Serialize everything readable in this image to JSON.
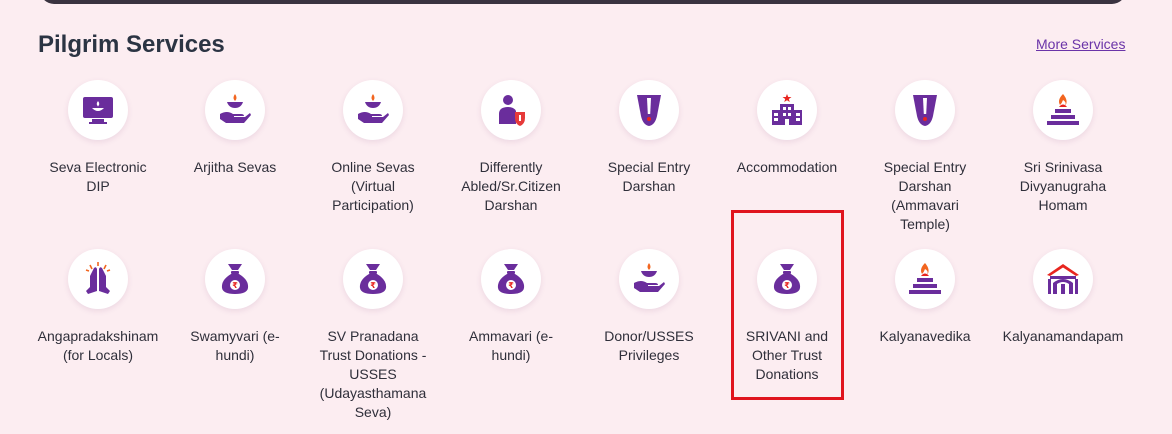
{
  "section": {
    "title": "Pilgrim Services",
    "more_link": "More Services"
  },
  "colors": {
    "page_background": "#fcedf1",
    "icon_purple": "#6a2d9c",
    "icon_orange": "#f2651f",
    "highlight_red": "#e0141e"
  },
  "services": [
    {
      "label": "Seva Electronic\nDIP",
      "icon": "monitor-lamp-icon"
    },
    {
      "label": "Arjitha Sevas",
      "icon": "hand-lamp-icon"
    },
    {
      "label": "Online Sevas\n(Virtual\nParticipation)",
      "icon": "hand-lamp-icon"
    },
    {
      "label": "Differently\nAbled/Sr.Citizen\nDarshan",
      "icon": "person-shield-icon"
    },
    {
      "label": "Special Entry\nDarshan",
      "icon": "namam-icon"
    },
    {
      "label": "Accommodation",
      "icon": "building-icon"
    },
    {
      "label": "Special Entry\nDarshan\n(Ammavari\nTemple)",
      "icon": "namam-icon"
    },
    {
      "label": "Sri Srinivasa\nDivyanugraha\nHomam",
      "icon": "homam-icon"
    },
    {
      "label": "Angapradakshinam\n(for Locals)",
      "icon": "praying-hands-icon"
    },
    {
      "label": "Swamyvari (e-\nhundi)",
      "icon": "money-bag-icon"
    },
    {
      "label": "SV Pranadana\nTrust Donations -\nUSSES\n(Udayasthamana\nSeva)",
      "icon": "money-bag-icon"
    },
    {
      "label": "Ammavari (e-\nhundi)",
      "icon": "money-bag-icon"
    },
    {
      "label": "Donor/USSES\nPrivileges",
      "icon": "hand-lamp-icon"
    },
    {
      "label": "SRIVANI and\nOther Trust\nDonations",
      "icon": "money-bag-icon"
    },
    {
      "label": "Kalyanavedika",
      "icon": "homam-icon"
    },
    {
      "label": "Kalyanamandapam",
      "icon": "hall-icon"
    }
  ]
}
